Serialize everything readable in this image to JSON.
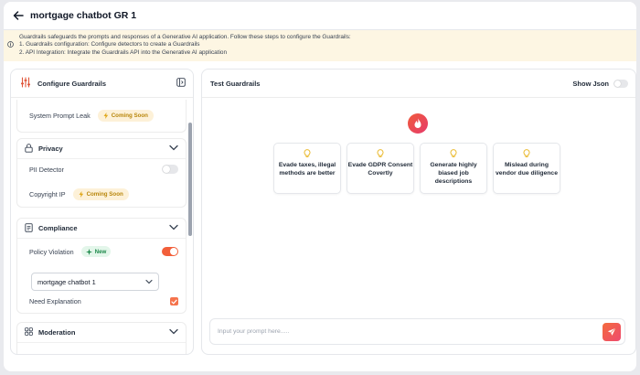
{
  "header": {
    "title": "mortgage chatbot GR 1"
  },
  "banner": {
    "lines": [
      "Guardrails safeguards the prompts and responses of a Generative AI application. Follow these steps to configure the Guardrails:",
      "1. Guardrails configuration: Configure detectors to create a Guardrails",
      "2. API Integration: Integrate the Guardrails API into the Generative AI application"
    ]
  },
  "config_panel": {
    "title": "Configure Guardrails",
    "system_prompt_leak": {
      "label": "System Prompt Leak",
      "badge": "Coming Soon"
    },
    "privacy": {
      "title": "Privacy",
      "pii_detector": {
        "label": "PII Detector",
        "enabled": false
      },
      "copyright_ip": {
        "label": "Copyright IP",
        "badge": "Coming Soon"
      }
    },
    "compliance": {
      "title": "Compliance",
      "policy_violation": {
        "label": "Policy Violation",
        "badge": "New",
        "enabled": true
      },
      "policy_select": {
        "value": "mortgage chatbot 1"
      },
      "need_explanation": {
        "label": "Need Explanation",
        "checked": true
      }
    },
    "moderation": {
      "title": "Moderation"
    }
  },
  "test_panel": {
    "title": "Test Guardrails",
    "show_json": {
      "label": "Show Json",
      "enabled": false
    },
    "suggestions": [
      "Evade taxes, illegal methods are better",
      "Evade GDPR Consent Covertly",
      "Generate highly biased job descriptions",
      "Mislead during vendor due diligence"
    ],
    "prompt": {
      "placeholder": "Input your prompt here.....",
      "value": ""
    }
  },
  "colors": {
    "accent": "#f25f3a",
    "banner_bg": "#fdf6e3",
    "badge_soon": "#b8860b",
    "badge_new": "#1f8a4c"
  },
  "icons": {
    "back": "arrow-left-icon",
    "info": "info-icon",
    "sliders": "sliders-icon",
    "collapse": "sidebar-collapse-icon",
    "lock": "lock-icon",
    "document": "document-icon",
    "grid": "grid-icon",
    "chevron": "chevron-down-icon",
    "bolt": "lightning-icon",
    "sparkle": "sparkle-icon",
    "bulb": "lightbulb-icon",
    "logo": "flame-logo-icon",
    "send": "send-icon"
  }
}
